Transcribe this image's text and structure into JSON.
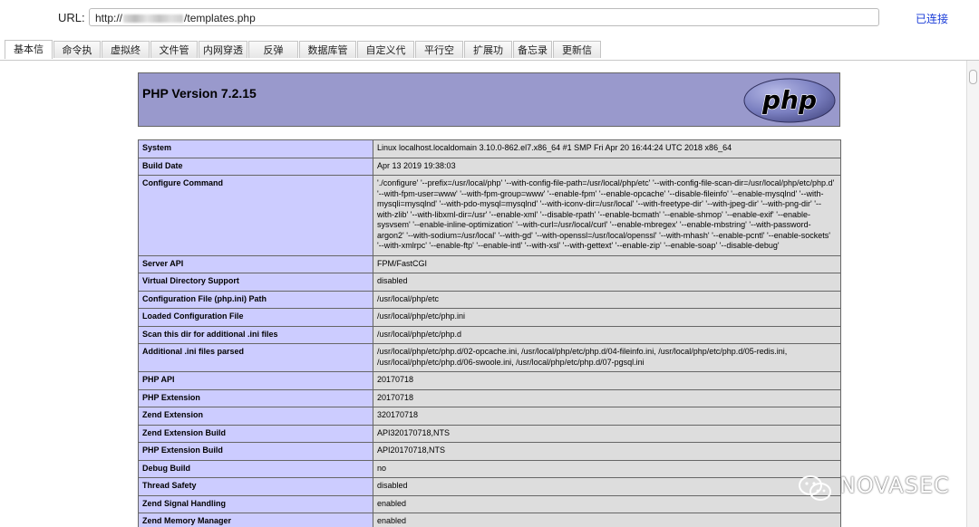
{
  "url_bar": {
    "label": "URL:",
    "url_prefix": "http://",
    "url_suffix": "/templates.php",
    "status": "已连接"
  },
  "tabs": [
    {
      "label": "基本信息",
      "active": true
    },
    {
      "label": "命令执行"
    },
    {
      "label": "虚拟终端"
    },
    {
      "label": "文件管理"
    },
    {
      "label": "内网穿透"
    },
    {
      "label": "反弹shell"
    },
    {
      "label": "数据库管理"
    },
    {
      "label": "自定义代码"
    },
    {
      "label": "平行空间"
    },
    {
      "label": "扩展功能"
    },
    {
      "label": "备忘录"
    },
    {
      "label": "更新信息"
    }
  ],
  "phpinfo": {
    "title": "PHP Version 7.2.15",
    "logo_text": "php",
    "rows": [
      {
        "key": "System",
        "value": "Linux localhost.localdomain 3.10.0-862.el7.x86_64 #1 SMP Fri Apr 20 16:44:24 UTC 2018 x86_64"
      },
      {
        "key": "Build Date",
        "value": "Apr 13 2019 19:38:03"
      },
      {
        "key": "Configure Command",
        "value": "'./configure' '--prefix=/usr/local/php' '--with-config-file-path=/usr/local/php/etc' '--with-config-file-scan-dir=/usr/local/php/etc/php.d' '--with-fpm-user=www' '--with-fpm-group=www' '--enable-fpm' '--enable-opcache' '--disable-fileinfo' '--enable-mysqlnd' '--with-mysqli=mysqlnd' '--with-pdo-mysql=mysqlnd' '--with-iconv-dir=/usr/local' '--with-freetype-dir' '--with-jpeg-dir' '--with-png-dir' '--with-zlib' '--with-libxml-dir=/usr' '--enable-xml' '--disable-rpath' '--enable-bcmath' '--enable-shmop' '--enable-exif' '--enable-sysvsem' '--enable-inline-optimization' '--with-curl=/usr/local/curl' '--enable-mbregex' '--enable-mbstring' '--with-password-argon2' '--with-sodium=/usr/local' '--with-gd' '--with-openssl=/usr/local/openssl' '--with-mhash' '--enable-pcntl' '--enable-sockets' '--with-xmlrpc' '--enable-ftp' '--enable-intl' '--with-xsl' '--with-gettext' '--enable-zip' '--enable-soap' '--disable-debug'"
      },
      {
        "key": "Server API",
        "value": "FPM/FastCGI"
      },
      {
        "key": "Virtual Directory Support",
        "value": "disabled"
      },
      {
        "key": "Configuration File (php.ini) Path",
        "value": "/usr/local/php/etc"
      },
      {
        "key": "Loaded Configuration File",
        "value": "/usr/local/php/etc/php.ini"
      },
      {
        "key": "Scan this dir for additional .ini files",
        "value": "/usr/local/php/etc/php.d"
      },
      {
        "key": "Additional .ini files parsed",
        "value": "/usr/local/php/etc/php.d/02-opcache.ini, /usr/local/php/etc/php.d/04-fileinfo.ini, /usr/local/php/etc/php.d/05-redis.ini, /usr/local/php/etc/php.d/06-swoole.ini, /usr/local/php/etc/php.d/07-pgsql.ini"
      },
      {
        "key": "PHP API",
        "value": "20170718"
      },
      {
        "key": "PHP Extension",
        "value": "20170718"
      },
      {
        "key": "Zend Extension",
        "value": "320170718"
      },
      {
        "key": "Zend Extension Build",
        "value": "API320170718,NTS"
      },
      {
        "key": "PHP Extension Build",
        "value": "API20170718,NTS"
      },
      {
        "key": "Debug Build",
        "value": "no"
      },
      {
        "key": "Thread Safety",
        "value": "disabled"
      },
      {
        "key": "Zend Signal Handling",
        "value": "enabled"
      },
      {
        "key": "Zend Memory Manager",
        "value": "enabled"
      }
    ]
  },
  "watermark": {
    "text": "NOVASEC",
    "icon": "wechat-icon"
  },
  "colors": {
    "header_bg": "#9999cc",
    "key_bg": "#ccccff",
    "value_bg": "#dddddd",
    "status_link": "#1a3cd8"
  }
}
